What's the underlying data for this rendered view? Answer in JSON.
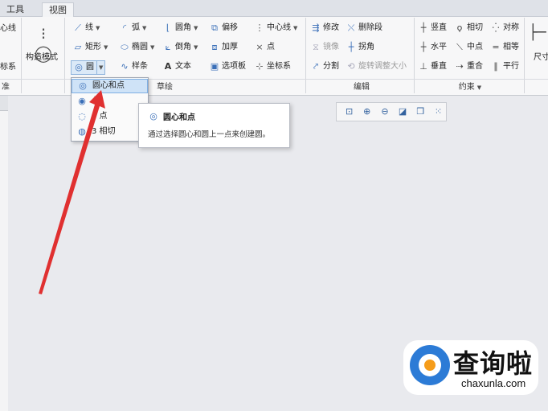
{
  "tabs": [
    {
      "label": "工具"
    },
    {
      "label": "视图"
    }
  ],
  "ribbon": {
    "col0": [
      "心线",
      "标系"
    ],
    "construct": "构造模式",
    "sketch": {
      "line": "线",
      "rect": "矩形",
      "circle": "圆",
      "arc": "弧",
      "ellipse": "椭圆",
      "spline": "样条",
      "fillet": "圆角",
      "chamfer": "倒角",
      "text": "文本",
      "offset": "偏移",
      "thicken": "加厚",
      "palette": "选项板",
      "centerline": "中心线",
      "point": "点",
      "coordsys": "坐标系"
    },
    "edit": {
      "modify": "修改",
      "mirror": "镜像",
      "divide": "分割",
      "delete_segment": "删除段",
      "corner": "拐角",
      "rotate_resize": "旋转调整大小"
    },
    "constrain": {
      "vertical": "竖直",
      "horizontal": "水平",
      "perpendicular": "垂直",
      "tangent": "相切",
      "midpoint": "中点",
      "coincident": "重合",
      "symmetric": "对称",
      "equal": "相等",
      "parallel": "平行"
    },
    "dimension": "尺寸",
    "groups": {
      "datum": "准",
      "sketch": "草绘",
      "edit": "编辑",
      "constrain": "约束"
    }
  },
  "circle_menu": {
    "items": [
      {
        "label": "圆心和点"
      },
      {
        "label": "心"
      },
      {
        "label": "3 点"
      },
      {
        "label": "3 相切"
      }
    ]
  },
  "tooltip": {
    "title": "圆心和点",
    "desc": "通过选择圆心和圆上一点来创建圆。"
  },
  "logo": {
    "cn": "查询啦",
    "en": "chaxunla.com"
  },
  "colors": {
    "arrow": "#e03030",
    "accent": "#2c7bd6",
    "logo_dot": "#f59c1a"
  }
}
